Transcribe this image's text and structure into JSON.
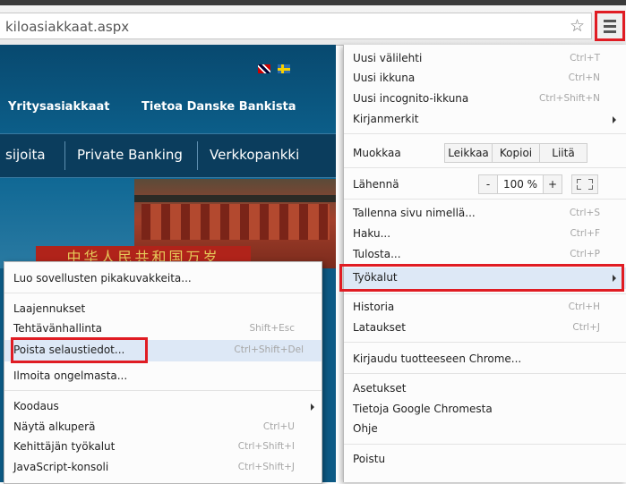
{
  "address_bar": {
    "url": "kiloasiakkaat.aspx"
  },
  "website": {
    "top_links": [
      "Yritysasiakkaat",
      "Tietoa Danske Bankista"
    ],
    "nav_items": [
      "sijoita",
      "Private Banking",
      "Verkkopankki"
    ],
    "banner_text": "中华人民共和国万岁"
  },
  "chrome_menu": {
    "new_tab": {
      "label": "Uusi välilehti",
      "shortcut": "Ctrl+T"
    },
    "new_window": {
      "label": "Uusi ikkuna",
      "shortcut": "Ctrl+N"
    },
    "new_incognito": {
      "label": "Uusi incognito-ikkuna",
      "shortcut": "Ctrl+Shift+N"
    },
    "bookmarks": {
      "label": "Kirjanmerkit"
    },
    "edit": {
      "label": "Muokkaa",
      "cut": "Leikkaa",
      "copy": "Kopioi",
      "paste": "Liitä"
    },
    "zoom": {
      "label": "Lähennä",
      "minus": "-",
      "value": "100 %",
      "plus": "+"
    },
    "save_page": {
      "label": "Tallenna sivu nimellä...",
      "shortcut": "Ctrl+S"
    },
    "find": {
      "label": "Haku...",
      "shortcut": "Ctrl+F"
    },
    "print": {
      "label": "Tulosta...",
      "shortcut": "Ctrl+P"
    },
    "tools": {
      "label": "Työkalut"
    },
    "history": {
      "label": "Historia",
      "shortcut": "Ctrl+H"
    },
    "downloads": {
      "label": "Lataukset",
      "shortcut": "Ctrl+J"
    },
    "sign_in": {
      "label": "Kirjaudu tuotteeseen Chrome..."
    },
    "settings": {
      "label": "Asetukset"
    },
    "about": {
      "label": "Tietoja Google Chromesta"
    },
    "help": {
      "label": "Ohje"
    },
    "exit": {
      "label": "Poistu"
    }
  },
  "tools_submenu": {
    "create_shortcuts": {
      "label": "Luo sovellusten pikakuvakkeita..."
    },
    "extensions": {
      "label": "Laajennukset"
    },
    "task_manager": {
      "label": "Tehtävänhallinta",
      "shortcut": "Shift+Esc"
    },
    "clear_data": {
      "label": "Poista selaustiedot...",
      "shortcut": "Ctrl+Shift+Del"
    },
    "report_issue": {
      "label": "Ilmoita ongelmasta..."
    },
    "encoding": {
      "label": "Koodaus"
    },
    "view_source": {
      "label": "Näytä alkuperä",
      "shortcut": "Ctrl+U"
    },
    "dev_tools": {
      "label": "Kehittäjän työkalut",
      "shortcut": "Ctrl+Shift+I"
    },
    "js_console": {
      "label": "JavaScript-konsoli",
      "shortcut": "Ctrl+Shift+J"
    }
  },
  "colors": {
    "highlight_border": "#e01c23",
    "menu_hover": "#dde8f6",
    "site_blue": "#0d5a85"
  }
}
